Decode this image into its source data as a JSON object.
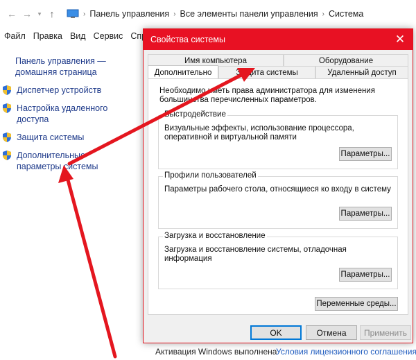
{
  "explorer": {
    "breadcrumb": [
      "Панель управления",
      "Все элементы панели управления",
      "Система"
    ],
    "menu": [
      "Файл",
      "Правка",
      "Вид",
      "Сервис",
      "Спр"
    ],
    "sidebar": {
      "home_link": "Панель управления — домашняя страница",
      "items": [
        {
          "label": "Диспетчер устройств"
        },
        {
          "label": "Настройка удаленного доступа"
        },
        {
          "label": "Защита системы"
        },
        {
          "label": "Дополнительные параметры системы"
        }
      ]
    },
    "footer": {
      "activation_text": "Активация Windows выполнена",
      "license_link": "Условия лицензионного соглашения на"
    }
  },
  "dialog": {
    "title": "Свойства системы",
    "close_glyph": "✕",
    "tabs_row1": [
      "Имя компьютера",
      "Оборудование"
    ],
    "tabs_row2": [
      "Дополнительно",
      "Защита системы",
      "Удаленный доступ"
    ],
    "active_tab": "Дополнительно",
    "intro": "Необходимо иметь права администратора для изменения большинства перечисленных параметров.",
    "groups": [
      {
        "label": "Быстродействие",
        "desc": "Визуальные эффекты, использование процессора, оперативной и виртуальной памяти",
        "button": "Параметры..."
      },
      {
        "label": "Профили пользователей",
        "desc": "Параметры рабочего стола, относящиеся ко входу в систему",
        "button": "Параметры..."
      },
      {
        "label": "Загрузка и восстановление",
        "desc": "Загрузка и восстановление системы, отладочная информация",
        "button": "Параметры..."
      }
    ],
    "env_button": "Переменные среды...",
    "buttons": {
      "ok": "OK",
      "cancel": "Отмена",
      "apply": "Применить"
    }
  },
  "colors": {
    "titlebar": "#e81123",
    "link": "#1e3a8a",
    "annotation_arrow": "#e4161f"
  }
}
